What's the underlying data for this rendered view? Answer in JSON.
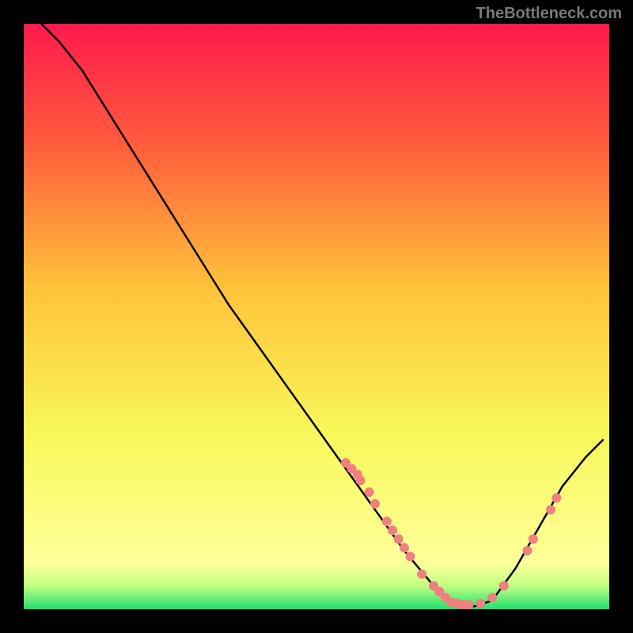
{
  "watermark": "TheBottleneck.com",
  "chart_data": {
    "type": "line",
    "title": "",
    "xlabel": "",
    "ylabel": "",
    "xlim": [
      0,
      100
    ],
    "ylim": [
      0,
      100
    ],
    "gradient_stops": [
      {
        "offset": 0,
        "color": "#ff1a4d"
      },
      {
        "offset": 20,
        "color": "#ff5a3d"
      },
      {
        "offset": 45,
        "color": "#ffc23a"
      },
      {
        "offset": 70,
        "color": "#f8f85a"
      },
      {
        "offset": 92,
        "color": "#ffff9a"
      },
      {
        "offset": 96,
        "color": "#c0ff80"
      },
      {
        "offset": 100,
        "color": "#20e070"
      }
    ],
    "curve": [
      {
        "x": 3,
        "y": 100
      },
      {
        "x": 6,
        "y": 97
      },
      {
        "x": 10,
        "y": 92
      },
      {
        "x": 15,
        "y": 84
      },
      {
        "x": 20,
        "y": 76
      },
      {
        "x": 25,
        "y": 68
      },
      {
        "x": 30,
        "y": 60
      },
      {
        "x": 35,
        "y": 52
      },
      {
        "x": 40,
        "y": 45
      },
      {
        "x": 45,
        "y": 38
      },
      {
        "x": 50,
        "y": 31
      },
      {
        "x": 55,
        "y": 24
      },
      {
        "x": 60,
        "y": 17
      },
      {
        "x": 65,
        "y": 10
      },
      {
        "x": 70,
        "y": 4
      },
      {
        "x": 73,
        "y": 1
      },
      {
        "x": 77,
        "y": 0.5
      },
      {
        "x": 80,
        "y": 1.5
      },
      {
        "x": 84,
        "y": 7
      },
      {
        "x": 88,
        "y": 14
      },
      {
        "x": 92,
        "y": 21
      },
      {
        "x": 96,
        "y": 26
      },
      {
        "x": 99,
        "y": 29
      }
    ],
    "points": [
      {
        "x": 55,
        "y": 25
      },
      {
        "x": 56,
        "y": 24
      },
      {
        "x": 57,
        "y": 23
      },
      {
        "x": 57.5,
        "y": 22
      },
      {
        "x": 59,
        "y": 20
      },
      {
        "x": 60,
        "y": 18
      },
      {
        "x": 62,
        "y": 15
      },
      {
        "x": 63,
        "y": 13.5
      },
      {
        "x": 64,
        "y": 12
      },
      {
        "x": 65,
        "y": 10.5
      },
      {
        "x": 66,
        "y": 9
      },
      {
        "x": 68,
        "y": 6
      },
      {
        "x": 70,
        "y": 4
      },
      {
        "x": 71,
        "y": 3
      },
      {
        "x": 72,
        "y": 2
      },
      {
        "x": 73,
        "y": 1.2
      },
      {
        "x": 74,
        "y": 1
      },
      {
        "x": 75,
        "y": 0.8
      },
      {
        "x": 76,
        "y": 0.8
      },
      {
        "x": 78,
        "y": 1
      },
      {
        "x": 80,
        "y": 2
      },
      {
        "x": 82,
        "y": 4
      },
      {
        "x": 86,
        "y": 10
      },
      {
        "x": 87,
        "y": 12
      },
      {
        "x": 90,
        "y": 17
      },
      {
        "x": 91,
        "y": 19
      }
    ],
    "point_color": "#f08080",
    "point_radius": 6,
    "curve_color": "#000000",
    "curve_width": 2.5
  }
}
